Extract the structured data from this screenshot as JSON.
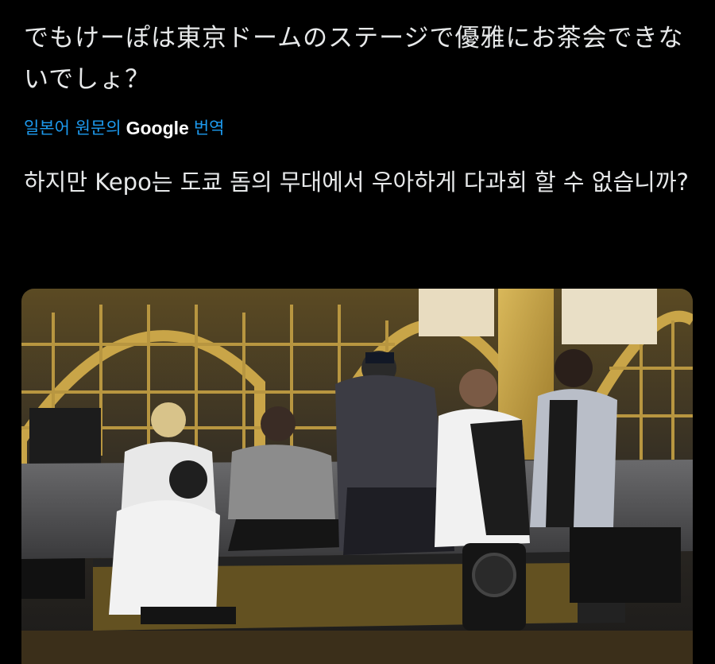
{
  "post": {
    "text": "でもけーぽは東京ドームのステージで優雅にお茶会できないでしょ？"
  },
  "translate": {
    "prefix": "일본어 원문의",
    "brand": "Google",
    "suffix": "번역"
  },
  "translated_text": "하지만 Kepo는 도쿄 돔의 무대에서 우아하게 다과회 할 수 없습니까?",
  "media": {
    "icon": "photo-image"
  },
  "colors": {
    "background": "#000000",
    "text": "#e7e9ea",
    "link": "#1d9bf0"
  }
}
